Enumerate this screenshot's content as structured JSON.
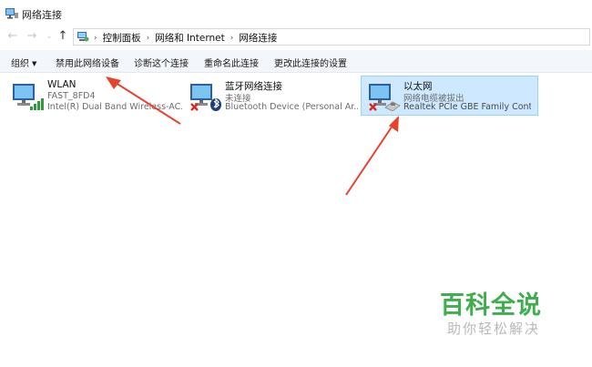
{
  "window": {
    "title": "网络连接"
  },
  "breadcrumb": [
    "控制面板",
    "网络和 Internet",
    "网络连接"
  ],
  "toolbar": {
    "organize": "组织",
    "disable_device": "禁用此网络设备",
    "diagnose": "诊断这个连接",
    "rename": "重命名此连接",
    "change_settings": "更改此连接的设置"
  },
  "adapters": [
    {
      "name": "WLAN",
      "status": "FAST_8FD4",
      "device": "Intel(R) Dual Band Wireless-AC...",
      "type": "wifi"
    },
    {
      "name": "蓝牙网络连接",
      "status": "未连接",
      "device": "Bluetooth Device (Personal Ar...",
      "type": "bluetooth"
    },
    {
      "name": "以太网",
      "status": "网络电缆被拔出",
      "device": "Realtek PCIe GBE Family Contr...",
      "type": "ethernet",
      "selected": true
    }
  ],
  "watermark": {
    "title": "百科全说",
    "subtitle": "助你轻松解决"
  },
  "colors": {
    "selection_bg": "#cde8ff",
    "selection_border": "#99d1ff",
    "arrow": "#e8412c",
    "watermark": "#3fae4e"
  }
}
